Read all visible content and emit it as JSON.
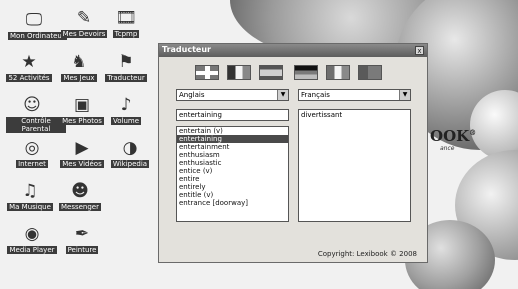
{
  "desktop": {
    "icons": [
      {
        "label": "Mon Ordinateur",
        "icon": "computer-icon"
      },
      {
        "label": "Mes Devoirs",
        "icon": "homework-icon"
      },
      {
        "label": "Tcpmp",
        "icon": "film-icon"
      },
      {
        "label": "52 Activités",
        "icon": "activities-icon"
      },
      {
        "label": "Mes Jeux",
        "icon": "games-icon"
      },
      {
        "label": "Traducteur",
        "icon": "translator-icon"
      },
      {
        "label": "Contrôle Parental",
        "icon": "parental-control-icon"
      },
      {
        "label": "Mes Photos",
        "icon": "photos-icon"
      },
      {
        "label": "Volume",
        "icon": "volume-icon"
      },
      {
        "label": "Internet",
        "icon": "internet-icon"
      },
      {
        "label": "Mes Vidéos",
        "icon": "videos-icon"
      },
      {
        "label": "Wikipedia",
        "icon": "wikipedia-icon"
      },
      {
        "label": "Ma Musique",
        "icon": "music-icon"
      },
      {
        "label": "Messenger",
        "icon": "messenger-icon"
      },
      {
        "label": "Media Player",
        "icon": "media-player-icon"
      },
      {
        "label": "Peinture",
        "icon": "paint-icon"
      }
    ]
  },
  "wallpaper": {
    "brand_text": "OOK",
    "brand_mark": "®",
    "brand_sub": "ance"
  },
  "translator": {
    "title": "Traducteur",
    "close_label": "x",
    "source_language": "Anglais",
    "target_language": "Français",
    "input_value": "entertaining",
    "word_list": [
      "entertain (v)",
      "entertaining",
      "entertainment",
      "enthusiasm",
      "enthusiastic",
      "entice (v)",
      "entire",
      "entirely",
      "entitle (v)",
      "entrance [doorway]"
    ],
    "selected_index": 1,
    "translation": "divertissant",
    "copyright": "Copyright: Lexibook © 2008",
    "flags": [
      "uk-flag-icon",
      "france-flag-icon",
      "spain-flag-icon",
      "germany-flag-icon",
      "italy-flag-icon",
      "portugal-flag-icon"
    ]
  }
}
